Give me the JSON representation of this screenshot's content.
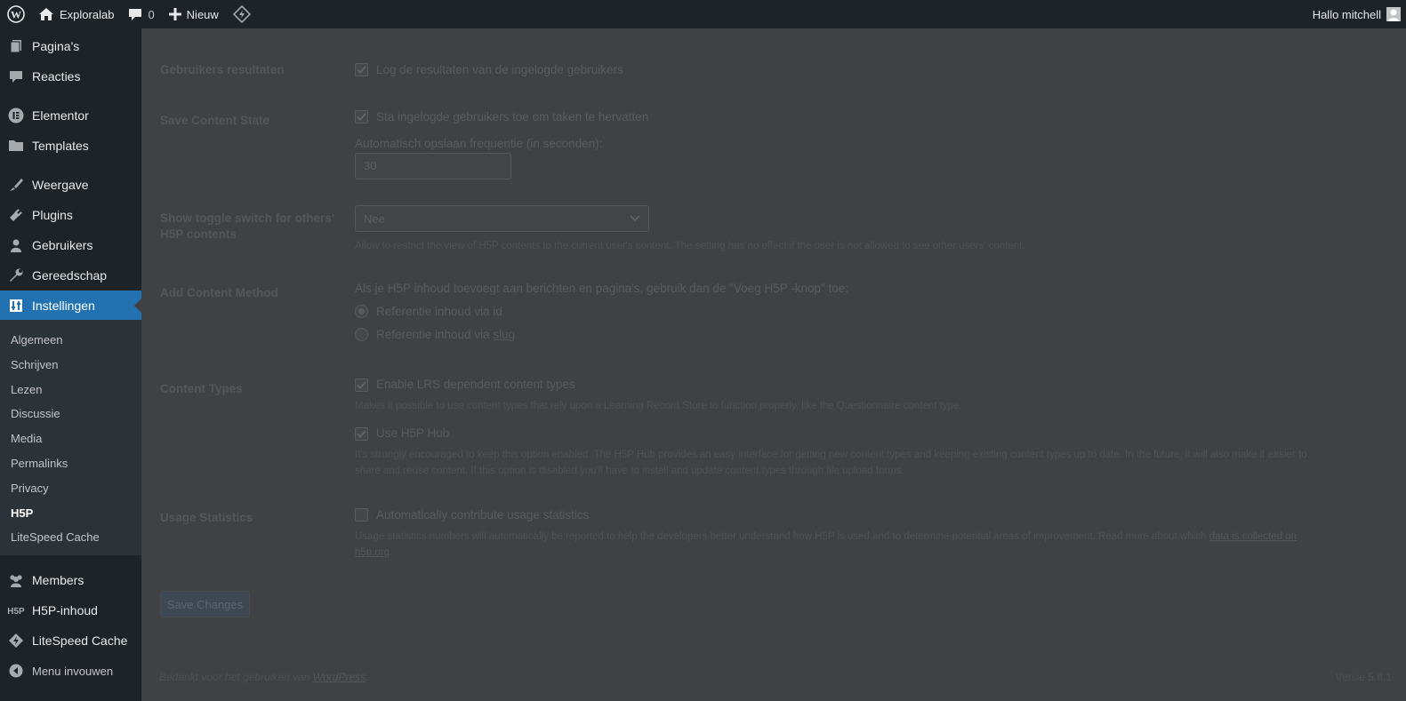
{
  "admin_bar": {
    "site_name": "Exploralab",
    "comments_count": "0",
    "new_label": "Nieuw",
    "greeting": "Hallo mitchell"
  },
  "sidebar": {
    "top_items": [
      {
        "label": "Pagina's",
        "icon": "pages-icon"
      },
      {
        "label": "Reacties",
        "icon": "comments-icon"
      },
      {
        "label": "Elementor",
        "icon": "elementor-icon"
      },
      {
        "label": "Templates",
        "icon": "folder-icon"
      },
      {
        "label": "Weergave",
        "icon": "paintbrush-icon"
      },
      {
        "label": "Plugins",
        "icon": "plugin-icon"
      },
      {
        "label": "Gebruikers",
        "icon": "users-icon"
      },
      {
        "label": "Gereedschap",
        "icon": "wrench-icon"
      },
      {
        "label": "Instellingen",
        "icon": "settings-icon"
      }
    ],
    "submenu": [
      "Algemeen",
      "Schrijven",
      "Lezen",
      "Discussie",
      "Media",
      "Permalinks",
      "Privacy",
      "H5P",
      "LiteSpeed Cache"
    ],
    "active_submenu": "H5P",
    "bottom_items": [
      {
        "label": "Members",
        "icon": "members-icon"
      },
      {
        "label": "H5P-inhoud",
        "icon": "h5p-icon"
      },
      {
        "label": "LiteSpeed Cache",
        "icon": "litespeed-icon"
      }
    ],
    "collapse_label": "Menu invouwen"
  },
  "settings": {
    "user_results": {
      "label": "Gebruikers resultaten",
      "checkbox_label": "Log de resultaten van de ingelogde gebruikers",
      "checked": true
    },
    "save_content_state": {
      "label": "Save Content State",
      "checkbox_label": "Sta ingelogde gebruikers toe om taken te hervatten",
      "checked": true,
      "frequency_label": "Automatisch opslaan frequentie (in seconden):",
      "frequency_value": "30"
    },
    "toggle_switch": {
      "label": "Show toggle switch for others' H5P contents",
      "selected": "Nee",
      "description": "Allow to restrict the view of H5P contents to the current user's content. The setting has no effect if the user is not allowed to see other users' content."
    },
    "add_content_method": {
      "label": "Add Content Method",
      "intro": "Als je H5P inhoud toevoegt aan berichten en pagina's, gebruik dan de \"Voeg H5P -knop\" toe:",
      "option_id": "Referentie inhoud via id",
      "option_slug_prefix": "Referentie inhoud via ",
      "option_slug_link": "slug",
      "selected": "id"
    },
    "content_types": {
      "label": "Content Types",
      "lrs_label": "Enable LRS dependent content types",
      "lrs_checked": true,
      "lrs_description": "Makes it possible to use content types that rely upon a Learning Record Store to function properly, like the Questionnaire content type.",
      "hub_label": "Use H5P Hub",
      "hub_checked": true,
      "hub_description_line1": "It's strongly encouraged to keep this option enabled. The H5P Hub provides an easy interface for getting new content types and keeping existing content types up to date. In the future, it will also make it easier to",
      "hub_description_line2": "share and reuse content. If this option is disabled you'll have to install and update content types through file upload forms."
    },
    "usage_statistics": {
      "label": "Usage Statistics",
      "checkbox_label": "Automatically contribute usage statistics",
      "checked": false,
      "description_text": "Usage statistics numbers will automatically be reported to help the developers better understand how H5P is used and to determine potential areas of improvement. Read more about which ",
      "description_link_part1": "data is collected on",
      "description_link_part2": "h5p.org",
      "description_end": "."
    },
    "save_button": "Save Changes"
  },
  "footer": {
    "thanks_prefix": "Bedankt voor het gebruiken van ",
    "thanks_link": "WordPress",
    "thanks_suffix": ".",
    "version": "Versie 5.8.1"
  },
  "colors": {
    "admin_bar_bg": "#1d2327",
    "current_menu": "#2271b1",
    "submenu_bg": "#2c3338",
    "overlay_bg": "#404142"
  }
}
